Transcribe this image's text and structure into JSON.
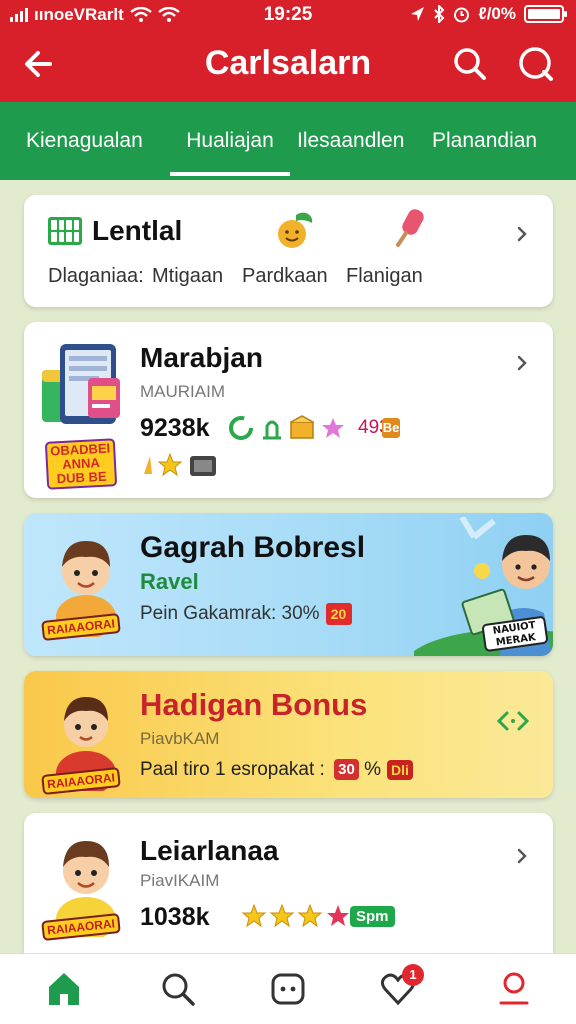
{
  "status": {
    "carrier": "ıınoeVRarlt",
    "time": "19:25",
    "battery": "ℓ/0%",
    "battery_level": 1.0
  },
  "header": {
    "title": "Carlsalarn"
  },
  "tabs": [
    {
      "label": "Kienagualan",
      "active": false
    },
    {
      "label": "Hualiajan",
      "active": true
    },
    {
      "label": "Ilesaandlen",
      "active": false
    },
    {
      "label": "Planandian",
      "active": false
    }
  ],
  "cards": {
    "lentlal": {
      "title": "Lentlal",
      "subs": [
        "Dlaganiaa:",
        "Mtigaan",
        "Pardkaan",
        "Flanigan"
      ]
    },
    "marabjan": {
      "title": "Marabjan",
      "subtitle": "MAURIAIM",
      "score": "9238k",
      "rating": "4936",
      "badge": "Be",
      "tablet_badge": "OBADBEI ANNA DUB BE"
    },
    "gagrah": {
      "title": "Gagrah Bobresl",
      "subtitle": "Ravel",
      "line": "Pein Gakamrak: 30%",
      "tag": "20",
      "person_badge": "NAUIOT MERAK"
    },
    "hadigan": {
      "title": "Hadigan Bonus",
      "subtitle": "PiavbKAM",
      "line": "Paal tiro 1 esropakat :",
      "pill": "30",
      "pct": "%",
      "pill2": "Dli"
    },
    "leiarlanaa": {
      "title": "Leiarlanaa",
      "subtitle": "PiavIKAIM",
      "score": "1038k",
      "tag": "Spm"
    }
  },
  "avatar_label": "RAIAAORAI",
  "nav": {
    "heart_count": "1"
  },
  "colors": {
    "header_red": "#d8202a",
    "tabs_green": "#1e9b4d",
    "page_bg": "#e3ebcf"
  }
}
